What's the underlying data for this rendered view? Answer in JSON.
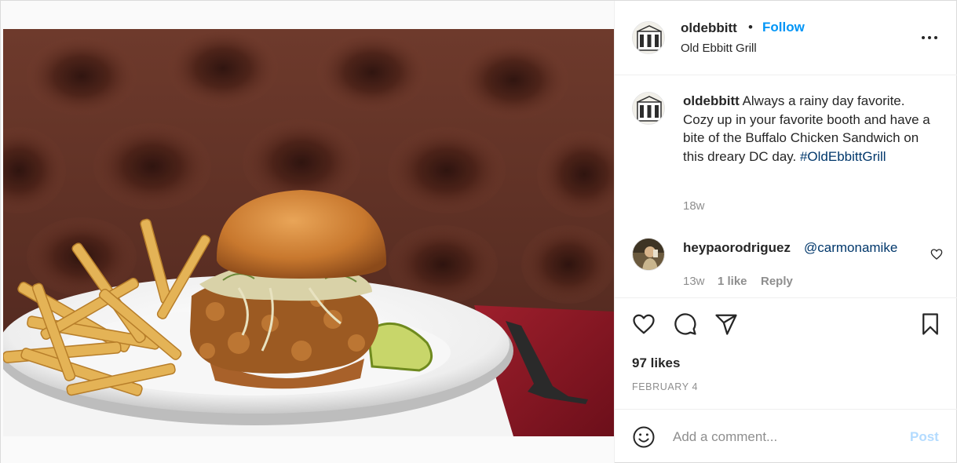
{
  "post": {
    "username": "oldebbitt",
    "separator": "•",
    "follow_label": "Follow",
    "location": "Old Ebbitt Grill",
    "more_icon": "more-options-icon"
  },
  "caption": {
    "username": "oldebbitt",
    "text": "Always a rainy day favorite. Cozy up in your favorite booth and have a bite of the Buffalo Chicken Sandwich on this dreary DC day.",
    "hashtag": "#OldEbbittGrill",
    "time": "18w"
  },
  "comment": {
    "username": "heypaorodriguez",
    "mention": "@carmonamike",
    "time": "13w",
    "likes": "1 like",
    "reply_label": "Reply"
  },
  "actions": {
    "icons": [
      "heart-icon",
      "comment-icon",
      "share-icon",
      "bookmark-icon"
    ],
    "likes": "97 likes",
    "date": "FEBRUARY 4"
  },
  "add_comment": {
    "placeholder": "Add a comment...",
    "post_label": "Post"
  },
  "colors": {
    "accent": "#0095f6",
    "link": "#00376b",
    "muted": "#8e8e8e",
    "post_disabled": "#b3dbff"
  }
}
